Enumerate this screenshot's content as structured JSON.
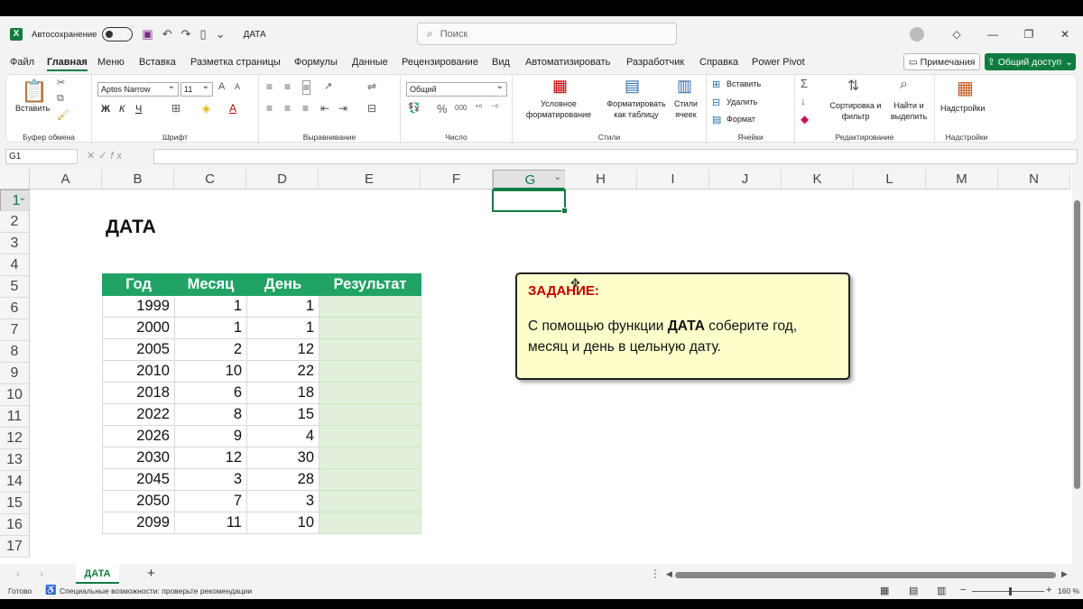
{
  "titlebar": {
    "autosave_label": "Автосохранение",
    "doc_name": "ДАТА",
    "search_placeholder": "Поиск"
  },
  "menu": {
    "items": [
      "Файл",
      "Главная",
      "Меню",
      "Вставка",
      "Разметка страницы",
      "Формулы",
      "Данные",
      "Рецензирование",
      "Вид",
      "Автоматизировать",
      "Разработчик",
      "Справка",
      "Power Pivot"
    ],
    "active": "Главная",
    "notes_label": "Примечания",
    "share_label": "Общий доступ"
  },
  "ribbon": {
    "paste_label": "Вставить",
    "clipboard_group": "Буфер обмена",
    "font_name": "Aptos Narrow",
    "font_size": "11",
    "font_group": "Шрифт",
    "align_group": "Выравнивание",
    "number_format": "Общий",
    "number_group": "Число",
    "cond_format": "Условное форматирование",
    "format_table": "Форматировать как таблицу",
    "cell_styles": "Стили ячеек",
    "styles_group": "Стили",
    "insert_label": "Вставить",
    "delete_label": "Удалить",
    "format_label": "Формат",
    "cells_group": "Ячейки",
    "sort_filter": "Сортировка и фильтр",
    "find_select": "Найти и выделить",
    "editing_group": "Редактирование",
    "addins_label": "Надстройки",
    "addins_group": "Надстройки"
  },
  "formula_bar": {
    "name_box": "G1",
    "formula": ""
  },
  "sheet": {
    "columns": [
      "A",
      "B",
      "C",
      "D",
      "E",
      "F",
      "G",
      "H",
      "I",
      "J",
      "K",
      "L",
      "M",
      "N"
    ],
    "rows": [
      "1",
      "2",
      "3",
      "4",
      "5",
      "6",
      "7",
      "8",
      "9",
      "10",
      "11",
      "12",
      "13",
      "14",
      "15",
      "16",
      "17"
    ],
    "selected_col": "G",
    "selected_row": "1",
    "title": "ДАТА",
    "table_headers": [
      "Год",
      "Месяц",
      "День",
      "Результат"
    ],
    "table_rows": [
      [
        "1999",
        "1",
        "1",
        ""
      ],
      [
        "2000",
        "1",
        "1",
        ""
      ],
      [
        "2005",
        "2",
        "12",
        ""
      ],
      [
        "2010",
        "10",
        "22",
        ""
      ],
      [
        "2018",
        "6",
        "18",
        ""
      ],
      [
        "2022",
        "8",
        "15",
        ""
      ],
      [
        "2026",
        "9",
        "4",
        ""
      ],
      [
        "2030",
        "12",
        "30",
        ""
      ],
      [
        "2045",
        "3",
        "28",
        ""
      ],
      [
        "2050",
        "7",
        "3",
        ""
      ],
      [
        "2099",
        "11",
        "10",
        ""
      ]
    ],
    "task_heading": "ЗАДАНИЕ:",
    "task_text_before": "С помощью функции ",
    "task_text_bold": "ДАТА",
    "task_text_after": " соберите год, месяц и день в цельную дату."
  },
  "tabs": {
    "active_sheet": "ДАТА"
  },
  "status": {
    "ready": "Готово",
    "accessibility": "Специальные возможности: проверьте рекомендации",
    "zoom": "160 %"
  },
  "colors": {
    "accent": "#107c41",
    "header_fill": "#21a366",
    "result_fill": "#e2efda",
    "task_fill": "#ffffcc",
    "task_heading": "#c00000"
  }
}
